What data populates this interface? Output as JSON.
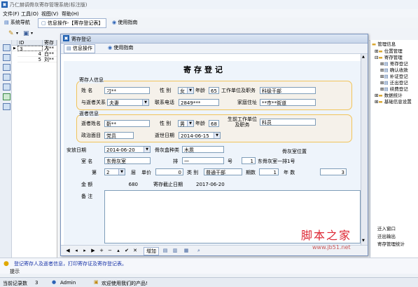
{
  "app": {
    "title": "乃仁赫调骨灰寄存管理系统(标注版)"
  },
  "menu": [
    "文件(F)",
    "工具(O)",
    "视图(V)",
    "帮助(H)"
  ],
  "tabs": {
    "nav": "系统导航",
    "current": "信息操作-【寄存登记表】",
    "guide": "使用指南"
  },
  "grid": {
    "headers": [
      "ID",
      "寄存人"
    ],
    "rows": [
      [
        "3",
        "刁**"
      ],
      [
        "4",
        "白**"
      ],
      [
        "5",
        "刘**"
      ]
    ]
  },
  "dialog": {
    "title": "寄存登记",
    "tab_info": "信息操作",
    "tab_guide": "使用指南",
    "form_title": "寄存登记",
    "depositor_section": "寄存人信息",
    "deceased_section": "逝者信息",
    "labels": {
      "name": "姓  名",
      "gender": "性 别",
      "age": "年龄",
      "work": "工作单位及职务",
      "relation": "与逝者关系",
      "phone": "联系电话",
      "address": "家庭住址",
      "dname": "逝者姓名",
      "dgender": "性 别",
      "dage": "年龄",
      "dwork": "生前工作单位及职务",
      "politics": "政治面目",
      "death_date": "逝世日期",
      "burial_date": "安放日期",
      "urn_type": "骨灰盒种类",
      "location": "骨灰室位置",
      "room": "室  名",
      "row": "排",
      "num": "号",
      "tier": "第",
      "tier_unit": "层",
      "price": "单价",
      "category": "类  别",
      "period": "期数",
      "year": "年  数",
      "amount": "金  额",
      "deadline": "寄存截止日期",
      "remark": "备  注"
    },
    "values": {
      "name": "刁**",
      "gender": "女",
      "age": "65",
      "work": "科级干部",
      "relation": "夫妻",
      "phone": "2849***",
      "address": "**市**街道",
      "dname": "靳**",
      "dgender": "男",
      "dage": "68",
      "dwork": "科员",
      "politics": "党员",
      "death_date": "2014-06-15",
      "burial_date": "2014-06-20",
      "urn_type": "木质",
      "location": "东骨灰室一排1号",
      "room": "东骨灰室",
      "row": "一",
      "num": "1",
      "tier": "2",
      "price": "0",
      "category": "普通干部",
      "period": "1",
      "years": "3",
      "amount": "680",
      "deadline": "2017-06-20"
    },
    "nav_add": "增加"
  },
  "tree": {
    "root": "管理信息",
    "items": [
      "位置管理",
      "寄存管理",
      "寄存登记",
      "确认收款",
      "补证登记",
      "迁出登记",
      "续费登记",
      "数据统计",
      "基础信息设置"
    ],
    "bottom": [
      "迁入窗口",
      "迁出输出",
      "寄存管理统计"
    ]
  },
  "tip": {
    "label": "提示",
    "text": "登记寄存人及逝者信息，打印寄存证及寄存登记表。"
  },
  "status": {
    "count_label": "当前记录数",
    "count": "3",
    "user": "Admin",
    "welcome": "欢迎使用我们的产品!"
  },
  "watermark": {
    "brand": "脚本之家",
    "url": "www.jb51.net"
  }
}
